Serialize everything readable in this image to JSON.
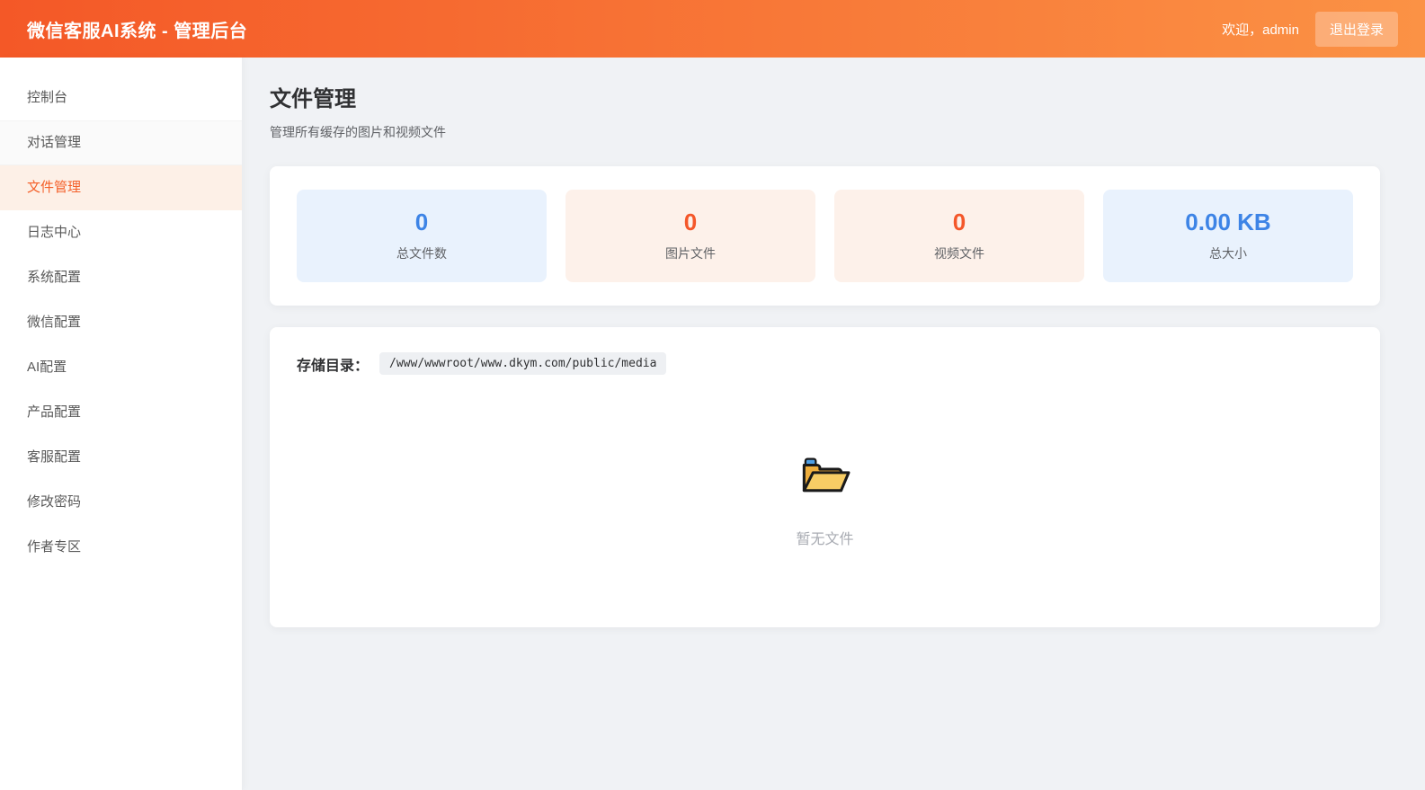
{
  "header": {
    "title": "微信客服AI系统 - 管理后台",
    "welcome": "欢迎，admin",
    "logout_label": "退出登录"
  },
  "sidebar": {
    "items": [
      {
        "label": "控制台",
        "state": "normal"
      },
      {
        "label": "对话管理",
        "state": "subtle"
      },
      {
        "label": "文件管理",
        "state": "active"
      },
      {
        "label": "日志中心",
        "state": "normal"
      },
      {
        "label": "系统配置",
        "state": "normal"
      },
      {
        "label": "微信配置",
        "state": "normal"
      },
      {
        "label": "AI配置",
        "state": "normal"
      },
      {
        "label": "产品配置",
        "state": "normal"
      },
      {
        "label": "客服配置",
        "state": "normal"
      },
      {
        "label": "修改密码",
        "state": "normal"
      },
      {
        "label": "作者专区",
        "state": "normal"
      }
    ]
  },
  "main": {
    "page_title": "文件管理",
    "page_subtitle": "管理所有缓存的图片和视频文件",
    "stats": [
      {
        "value": "0",
        "label": "总文件数",
        "theme": "blue"
      },
      {
        "value": "0",
        "label": "图片文件",
        "theme": "orange"
      },
      {
        "value": "0",
        "label": "视频文件",
        "theme": "orange"
      },
      {
        "value": "0.00 KB",
        "label": "总大小",
        "theme": "blue"
      }
    ],
    "storage": {
      "label": "存储目录：",
      "path": "/www/wwwroot/www.dkym.com/public/media"
    },
    "empty": {
      "icon": "open-folder-icon",
      "text": "暂无文件"
    }
  },
  "colors": {
    "header_gradient_start": "#f45827",
    "header_gradient_end": "#fb9245",
    "accent_orange": "#f4572a",
    "accent_blue": "#3d84e6",
    "stat_bg_blue": "#e9f2fd",
    "stat_bg_orange": "#fdf1ea",
    "active_item_bg": "#fdf0e7",
    "active_item_text": "#f4602a",
    "main_bg": "#f0f2f5"
  }
}
